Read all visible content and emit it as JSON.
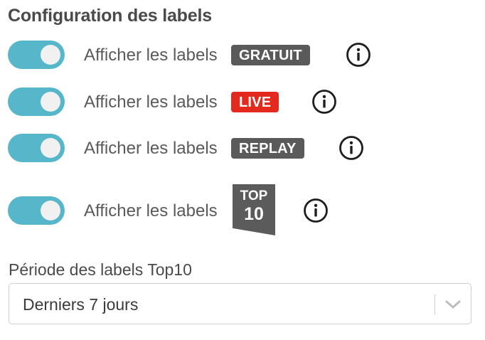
{
  "title": "Configuration des labels",
  "rows": [
    {
      "label": "Afficher les labels",
      "badge": "GRATUIT",
      "badge_color": "#5a5a5a",
      "enabled": true
    },
    {
      "label": "Afficher les labels",
      "badge": "LIVE",
      "badge_color": "#e4291e",
      "enabled": true
    },
    {
      "label": "Afficher les labels",
      "badge": "REPLAY",
      "badge_color": "#5a5a5a",
      "enabled": true
    },
    {
      "label": "Afficher les labels",
      "badge_top": "TOP",
      "badge_bottom": "10",
      "badge_color": "#5b5b5b",
      "enabled": true
    }
  ],
  "toggle_color": "#55b7c9",
  "icons": {
    "info": "info-circle-icon",
    "dropdown": "chevron-down-icon"
  },
  "period": {
    "label": "Période des labels Top10",
    "value": "Derniers 7 jours"
  }
}
